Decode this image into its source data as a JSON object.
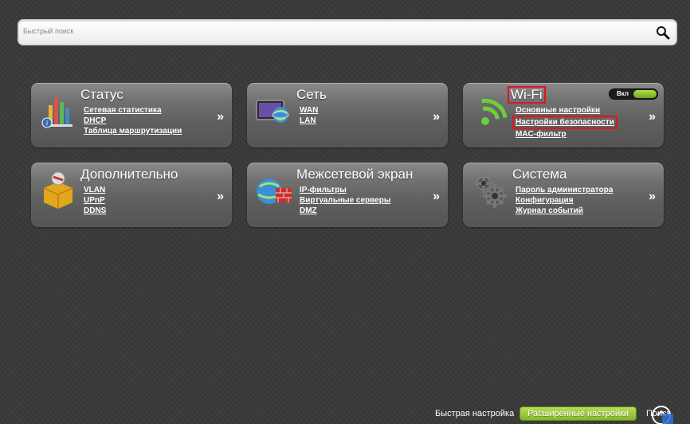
{
  "search": {
    "placeholder": "Быстрый поиск",
    "value": ""
  },
  "tiles": {
    "status": {
      "title": "Статус",
      "links": [
        "Сетевая статистика",
        "DHCP",
        "Таблица маршрутизации"
      ],
      "arrow": "»"
    },
    "network": {
      "title": "Сеть",
      "links": [
        "WAN",
        "LAN"
      ],
      "arrow": "»"
    },
    "wifi": {
      "title": "Wi-Fi",
      "toggle_label": "Вкл",
      "links": [
        "Основные настройки",
        "Настройки безопасности",
        "MAC-фильтр"
      ],
      "arrow": "»"
    },
    "advanced": {
      "title": "Дополнительно",
      "links": [
        "VLAN",
        "UPnP",
        "DDNS"
      ],
      "arrow": "»"
    },
    "firewall": {
      "title": "Межсетевой экран",
      "links": [
        "IP-фильтры",
        "Виртуальные серверы",
        "DMZ"
      ],
      "arrow": "»"
    },
    "system": {
      "title": "Система",
      "links": [
        "Пароль администратора",
        "Конфигурация",
        "Журнал событий"
      ],
      "arrow": "»"
    }
  },
  "footer": {
    "quick_setup": "Быстрая настройка",
    "advanced_settings": "Расширенные настройки",
    "search": "Поиск"
  },
  "colors": {
    "accent_green": "#8fbf2e",
    "highlight_red": "#e2141c",
    "background": "#3a3a3a"
  },
  "icons": [
    "search-icon",
    "status-chart-icon",
    "network-globe-icon",
    "wifi-signal-icon",
    "advanced-box-icon",
    "firewall-globe-icon",
    "system-gears-icon",
    "corner-badge-icon"
  ]
}
